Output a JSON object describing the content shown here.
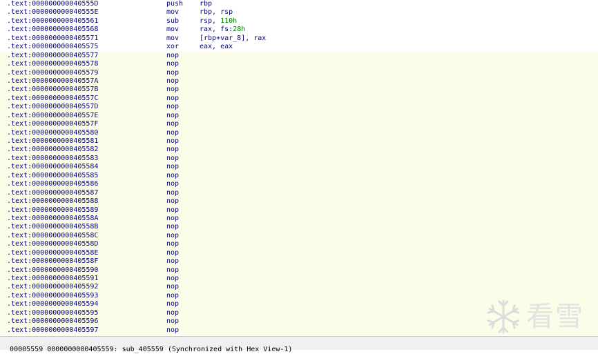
{
  "disassembly": {
    "rows": [
      {
        "address": ".text:000000000040555D",
        "mnemonic": "push",
        "ops": [
          {
            "t": "rbp",
            "k": "plain"
          }
        ],
        "highlight": false
      },
      {
        "address": ".text:000000000040555E",
        "mnemonic": "mov",
        "ops": [
          {
            "t": "rbp, rsp",
            "k": "plain"
          }
        ],
        "highlight": false
      },
      {
        "address": ".text:0000000000405561",
        "mnemonic": "sub",
        "ops": [
          {
            "t": "rsp, ",
            "k": "plain"
          },
          {
            "t": "110h",
            "k": "num"
          }
        ],
        "highlight": false
      },
      {
        "address": ".text:0000000000405568",
        "mnemonic": "mov",
        "ops": [
          {
            "t": "rax, fs:",
            "k": "plain"
          },
          {
            "t": "28h",
            "k": "num"
          }
        ],
        "highlight": false
      },
      {
        "address": ".text:0000000000405571",
        "mnemonic": "mov",
        "ops": [
          {
            "t": "[rbp+var_8], rax",
            "k": "plain"
          }
        ],
        "highlight": false
      },
      {
        "address": ".text:0000000000405575",
        "mnemonic": "xor",
        "ops": [
          {
            "t": "eax, eax",
            "k": "plain"
          }
        ],
        "highlight": false
      },
      {
        "address": ".text:0000000000405577",
        "mnemonic": "nop",
        "ops": [],
        "highlight": true
      },
      {
        "address": ".text:0000000000405578",
        "mnemonic": "nop",
        "ops": [],
        "highlight": true
      },
      {
        "address": ".text:0000000000405579",
        "mnemonic": "nop",
        "ops": [],
        "highlight": true
      },
      {
        "address": ".text:000000000040557A",
        "mnemonic": "nop",
        "ops": [],
        "highlight": true
      },
      {
        "address": ".text:000000000040557B",
        "mnemonic": "nop",
        "ops": [],
        "highlight": true
      },
      {
        "address": ".text:000000000040557C",
        "mnemonic": "nop",
        "ops": [],
        "highlight": true
      },
      {
        "address": ".text:000000000040557D",
        "mnemonic": "nop",
        "ops": [],
        "highlight": true
      },
      {
        "address": ".text:000000000040557E",
        "mnemonic": "nop",
        "ops": [],
        "highlight": true
      },
      {
        "address": ".text:000000000040557F",
        "mnemonic": "nop",
        "ops": [],
        "highlight": true
      },
      {
        "address": ".text:0000000000405580",
        "mnemonic": "nop",
        "ops": [],
        "highlight": true
      },
      {
        "address": ".text:0000000000405581",
        "mnemonic": "nop",
        "ops": [],
        "highlight": true
      },
      {
        "address": ".text:0000000000405582",
        "mnemonic": "nop",
        "ops": [],
        "highlight": true
      },
      {
        "address": ".text:0000000000405583",
        "mnemonic": "nop",
        "ops": [],
        "highlight": true
      },
      {
        "address": ".text:0000000000405584",
        "mnemonic": "nop",
        "ops": [],
        "highlight": true
      },
      {
        "address": ".text:0000000000405585",
        "mnemonic": "nop",
        "ops": [],
        "highlight": true
      },
      {
        "address": ".text:0000000000405586",
        "mnemonic": "nop",
        "ops": [],
        "highlight": true
      },
      {
        "address": ".text:0000000000405587",
        "mnemonic": "nop",
        "ops": [],
        "highlight": true
      },
      {
        "address": ".text:0000000000405588",
        "mnemonic": "nop",
        "ops": [],
        "highlight": true
      },
      {
        "address": ".text:0000000000405589",
        "mnemonic": "nop",
        "ops": [],
        "highlight": true
      },
      {
        "address": ".text:000000000040558A",
        "mnemonic": "nop",
        "ops": [],
        "highlight": true
      },
      {
        "address": ".text:000000000040558B",
        "mnemonic": "nop",
        "ops": [],
        "highlight": true
      },
      {
        "address": ".text:000000000040558C",
        "mnemonic": "nop",
        "ops": [],
        "highlight": true
      },
      {
        "address": ".text:000000000040558D",
        "mnemonic": "nop",
        "ops": [],
        "highlight": true
      },
      {
        "address": ".text:000000000040558E",
        "mnemonic": "nop",
        "ops": [],
        "highlight": true
      },
      {
        "address": ".text:000000000040558F",
        "mnemonic": "nop",
        "ops": [],
        "highlight": true
      },
      {
        "address": ".text:0000000000405590",
        "mnemonic": "nop",
        "ops": [],
        "highlight": true
      },
      {
        "address": ".text:0000000000405591",
        "mnemonic": "nop",
        "ops": [],
        "highlight": true
      },
      {
        "address": ".text:0000000000405592",
        "mnemonic": "nop",
        "ops": [],
        "highlight": true
      },
      {
        "address": ".text:0000000000405593",
        "mnemonic": "nop",
        "ops": [],
        "highlight": true
      },
      {
        "address": ".text:0000000000405594",
        "mnemonic": "nop",
        "ops": [],
        "highlight": true
      },
      {
        "address": ".text:0000000000405595",
        "mnemonic": "nop",
        "ops": [],
        "highlight": true
      },
      {
        "address": ".text:0000000000405596",
        "mnemonic": "nop",
        "ops": [],
        "highlight": true
      },
      {
        "address": ".text:0000000000405597",
        "mnemonic": "nop",
        "ops": [],
        "highlight": true
      }
    ]
  },
  "status_bar": {
    "text": "00005559 0000000000405559: sub_405559 (Synchronized with Hex View-1)"
  },
  "watermark": {
    "icon": "snowflake-icon",
    "text": "看雪"
  },
  "colors": {
    "text": "#000080",
    "number": "#008000",
    "highlight_bg": "#fbfde8",
    "status_bg": "#f0f0f0"
  }
}
